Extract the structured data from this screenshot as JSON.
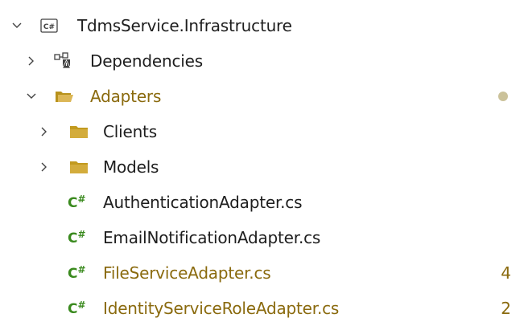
{
  "tree": {
    "project": {
      "label": "TdmsService.Infrastructure",
      "icon": "csharp-project-icon",
      "expanded": true
    },
    "dependencies": {
      "label": "Dependencies",
      "icon": "dependencies-icon",
      "expanded": false
    },
    "adapters": {
      "label": "Adapters",
      "icon": "open-folder-icon",
      "expanded": true,
      "status": "modified-dot"
    },
    "clients": {
      "label": "Clients",
      "icon": "folder-icon",
      "expanded": false
    },
    "models": {
      "label": "Models",
      "icon": "folder-icon",
      "expanded": false
    },
    "files": [
      {
        "label": "AuthenticationAdapter.cs",
        "icon": "csharp-file-icon",
        "badge": ""
      },
      {
        "label": "EmailNotificationAdapter.cs",
        "icon": "csharp-file-icon",
        "badge": ""
      },
      {
        "label": "FileServiceAdapter.cs",
        "icon": "csharp-file-icon",
        "badge": "4"
      },
      {
        "label": "IdentityServiceRoleAdapter.cs",
        "icon": "csharp-file-icon",
        "badge": "2"
      }
    ],
    "icon_text": {
      "project": "C#",
      "csharp": "C",
      "csharp_sup": "#"
    },
    "colors": {
      "modified_text": "#8a6a0e",
      "csharp_green": "#3a8a1e",
      "folder": "#c9a227",
      "dot": "#cbc29a"
    }
  }
}
